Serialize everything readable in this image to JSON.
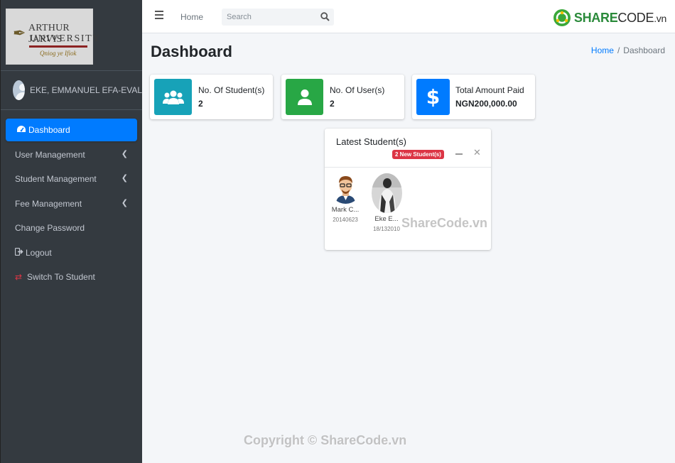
{
  "sidebar": {
    "logo": {
      "line1": "ARTHUR JARVIS",
      "line2": "UNIVERSITY",
      "motto": "Qniog ye Ifiok"
    },
    "user_name": "EKE, EMMANUEL EFA-EVAL",
    "items": [
      {
        "label": "Dashboard",
        "icon": "tachometer-icon",
        "active": true
      },
      {
        "label": "User Management",
        "has_submenu": true
      },
      {
        "label": "Student Management",
        "has_submenu": true
      },
      {
        "label": "Fee Management",
        "has_submenu": true
      },
      {
        "label": "Change Password"
      },
      {
        "label": "Logout",
        "icon": "sign-out-icon"
      },
      {
        "label": "Switch To Student",
        "icon": "exchange-icon"
      }
    ]
  },
  "topbar": {
    "home_label": "Home",
    "search_placeholder": "Search",
    "brand": {
      "part1": "SHARE",
      "part2": "CODE",
      "part3": ".vn"
    }
  },
  "page": {
    "title": "Dashboard",
    "breadcrumb": {
      "home": "Home",
      "current": "Dashboard"
    }
  },
  "info_boxes": [
    {
      "label": "No. Of Student(s)",
      "value": "2",
      "icon": "users-icon",
      "color": "#17a2b8"
    },
    {
      "label": "No. Of User(s)",
      "value": "2",
      "icon": "user-icon",
      "color": "#28a745"
    },
    {
      "label": "Total Amount Paid",
      "value": "NGN200,000.00",
      "icon": "dollar-icon",
      "color": "#007bff"
    }
  ],
  "latest_students": {
    "title": "Latest Student(s)",
    "badge": "2 New Student(s)",
    "members": [
      {
        "name": "Mark C...",
        "id": "20140623"
      },
      {
        "name": "Eke E...",
        "id": "18/132010"
      }
    ]
  },
  "watermarks": {
    "center": "ShareCode.vn",
    "footer": "Copyright © ShareCode.vn"
  },
  "colors": {
    "sidebar_bg": "#343a40",
    "active_blue": "#007bff",
    "content_bg": "#f4f6f9",
    "badge_red": "#dc3545"
  }
}
